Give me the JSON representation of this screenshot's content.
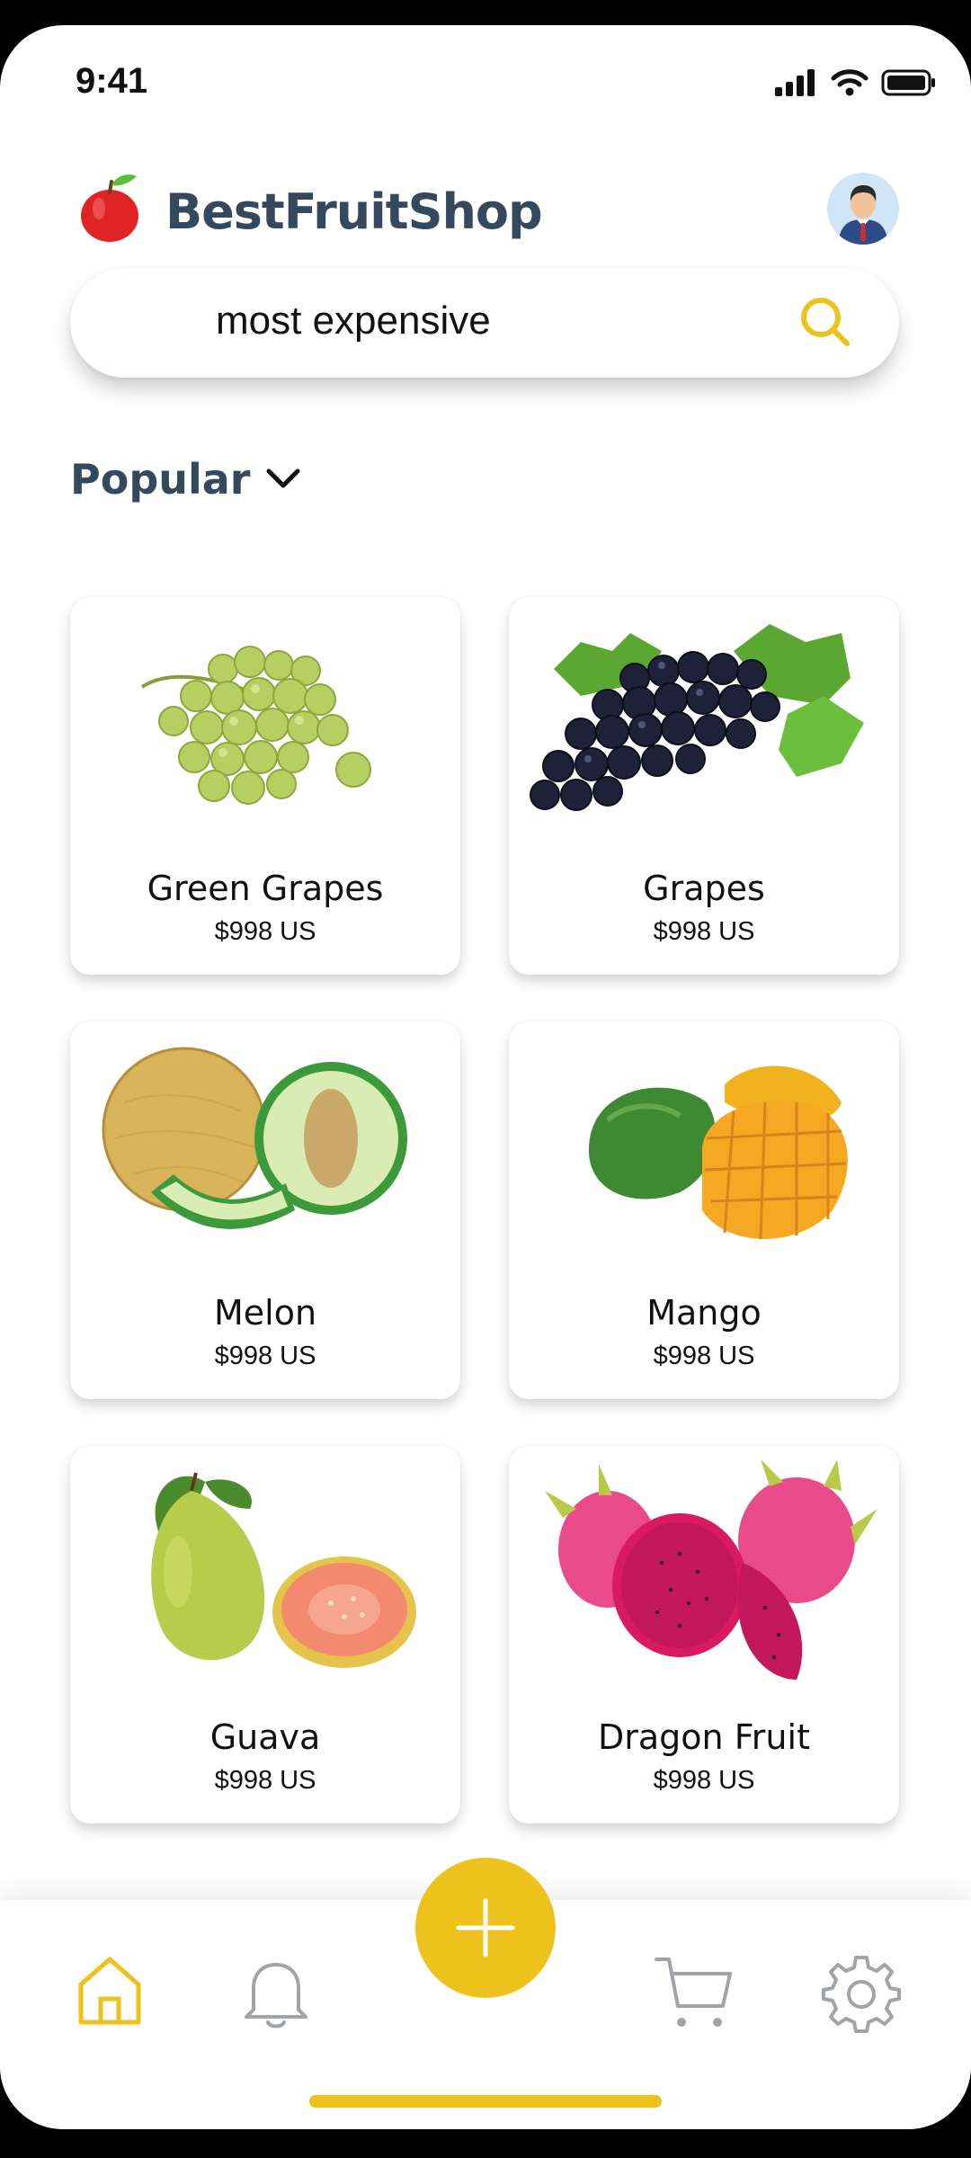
{
  "status_bar": {
    "time": "9:41"
  },
  "header": {
    "brand": "BestFruitShop",
    "logo_icon": "apple-icon",
    "avatar_icon": "user-avatar"
  },
  "search": {
    "value": "most expensive",
    "icon": "search-icon"
  },
  "filter": {
    "label": "Popular",
    "icon": "chevron-down-icon"
  },
  "products": [
    {
      "name": "Green Grapes",
      "price": "$998 US"
    },
    {
      "name": "Grapes",
      "price": "$998 US"
    },
    {
      "name": "Melon",
      "price": "$998 US"
    },
    {
      "name": "Mango",
      "price": "$998 US"
    },
    {
      "name": "Guava",
      "price": "$998 US"
    },
    {
      "name": "Dragon Fruit",
      "price": "$998 US"
    }
  ],
  "bottom_nav": {
    "items": [
      "home-icon",
      "bell-icon",
      "plus-icon",
      "cart-icon",
      "gear-icon"
    ],
    "active": "home-icon"
  },
  "colors": {
    "accent": "#EEC21C",
    "brand_text": "#34495E",
    "inactive_icon": "#A0A4A8"
  }
}
